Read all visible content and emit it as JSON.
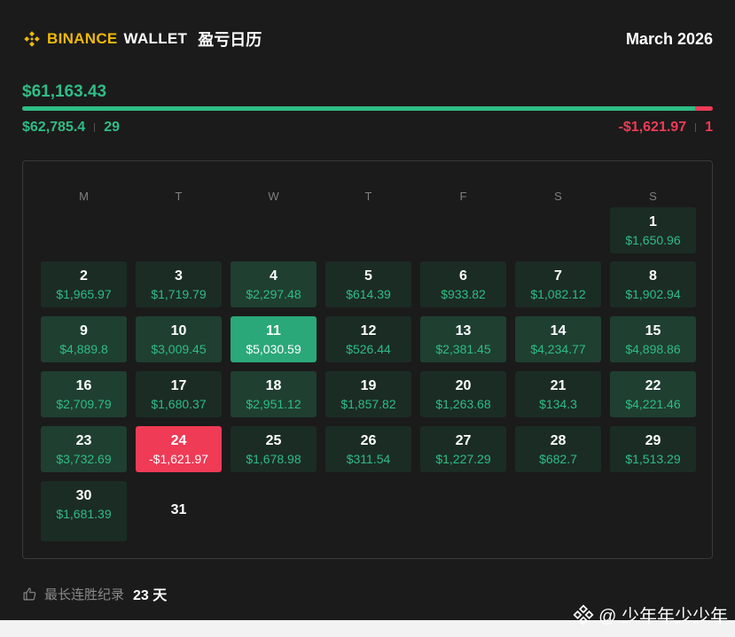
{
  "header": {
    "brand": "BINANCE",
    "wallet": "WALLET",
    "title": "盈亏日历",
    "month": "March 2026"
  },
  "summary": {
    "net": "$61,163.43",
    "gain_total": "$62,785.4",
    "gain_days": "29",
    "loss_total": "-$1,621.97",
    "loss_days": "1",
    "gain_fraction": 0.974
  },
  "weekdays": [
    "M",
    "T",
    "W",
    "T",
    "F",
    "S",
    "S"
  ],
  "days": [
    {
      "day": "1",
      "value": "$1,650.96",
      "level": "lv1",
      "row": 0,
      "col": 6
    },
    {
      "day": "2",
      "value": "$1,965.97",
      "level": "lv1",
      "row": 1,
      "col": 0
    },
    {
      "day": "3",
      "value": "$1,719.79",
      "level": "lv1",
      "row": 1,
      "col": 1
    },
    {
      "day": "4",
      "value": "$2,297.48",
      "level": "lv2",
      "row": 1,
      "col": 2
    },
    {
      "day": "5",
      "value": "$614.39",
      "level": "lv1",
      "row": 1,
      "col": 3
    },
    {
      "day": "6",
      "value": "$933.82",
      "level": "lv1",
      "row": 1,
      "col": 4
    },
    {
      "day": "7",
      "value": "$1,082.12",
      "level": "lv1",
      "row": 1,
      "col": 5
    },
    {
      "day": "8",
      "value": "$1,902.94",
      "level": "lv1",
      "row": 1,
      "col": 6
    },
    {
      "day": "9",
      "value": "$4,889.8",
      "level": "lv2",
      "row": 2,
      "col": 0
    },
    {
      "day": "10",
      "value": "$3,009.45",
      "level": "lv2",
      "row": 2,
      "col": 1
    },
    {
      "day": "11",
      "value": "$5,030.59",
      "level": "lv3",
      "row": 2,
      "col": 2
    },
    {
      "day": "12",
      "value": "$526.44",
      "level": "lv1",
      "row": 2,
      "col": 3
    },
    {
      "day": "13",
      "value": "$2,381.45",
      "level": "lv2",
      "row": 2,
      "col": 4
    },
    {
      "day": "14",
      "value": "$4,234.77",
      "level": "lv2",
      "row": 2,
      "col": 5
    },
    {
      "day": "15",
      "value": "$4,898.86",
      "level": "lv2",
      "row": 2,
      "col": 6
    },
    {
      "day": "16",
      "value": "$2,709.79",
      "level": "lv2",
      "row": 3,
      "col": 0
    },
    {
      "day": "17",
      "value": "$1,680.37",
      "level": "lv1",
      "row": 3,
      "col": 1
    },
    {
      "day": "18",
      "value": "$2,951.12",
      "level": "lv2",
      "row": 3,
      "col": 2
    },
    {
      "day": "19",
      "value": "$1,857.82",
      "level": "lv1",
      "row": 3,
      "col": 3
    },
    {
      "day": "20",
      "value": "$1,263.68",
      "level": "lv1",
      "row": 3,
      "col": 4
    },
    {
      "day": "21",
      "value": "$134.3",
      "level": "lv1",
      "row": 3,
      "col": 5
    },
    {
      "day": "22",
      "value": "$4,221.46",
      "level": "lv2",
      "row": 3,
      "col": 6
    },
    {
      "day": "23",
      "value": "$3,732.69",
      "level": "lv2",
      "row": 4,
      "col": 0
    },
    {
      "day": "24",
      "value": "-$1,621.97",
      "level": "neg",
      "row": 4,
      "col": 1
    },
    {
      "day": "25",
      "value": "$1,678.98",
      "level": "lv1",
      "row": 4,
      "col": 2
    },
    {
      "day": "26",
      "value": "$311.54",
      "level": "lv1",
      "row": 4,
      "col": 3
    },
    {
      "day": "27",
      "value": "$1,227.29",
      "level": "lv1",
      "row": 4,
      "col": 4
    },
    {
      "day": "28",
      "value": "$682.7",
      "level": "lv1",
      "row": 4,
      "col": 5
    },
    {
      "day": "29",
      "value": "$1,513.29",
      "level": "lv1",
      "row": 4,
      "col": 6
    },
    {
      "day": "30",
      "value": "$1,681.39",
      "level": "lv1",
      "row": 5,
      "col": 0
    },
    {
      "day": "31",
      "value": "",
      "level": "empty",
      "row": 5,
      "col": 1
    }
  ],
  "footer": {
    "streak_label": "最长连胜纪录",
    "streak_value": "23 天"
  },
  "watermark": "@ 少年年少少年",
  "colors": {
    "gain": "#2ebd85",
    "loss": "#ef3b56",
    "brand": "#f0b90b",
    "background": "#1b1b1b"
  }
}
